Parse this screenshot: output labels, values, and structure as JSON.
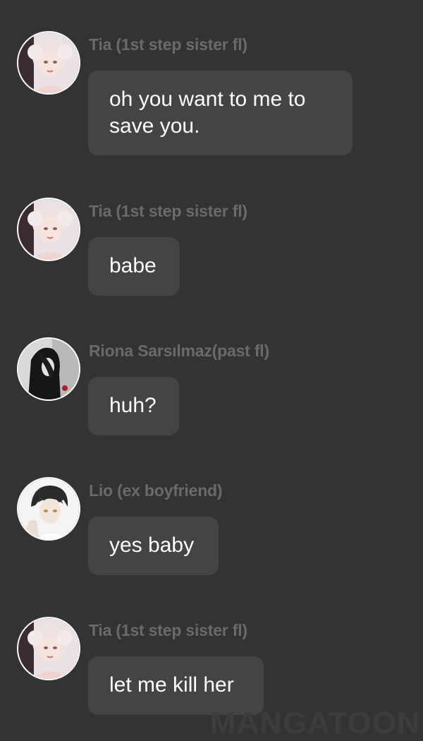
{
  "messages": [
    {
      "sender": "Tia (1st step sister fl)",
      "text": "oh you want to me to save you.",
      "avatar": "tia-avatar"
    },
    {
      "sender": "Tia (1st step sister fl)",
      "text": "babe",
      "avatar": "tia-avatar"
    },
    {
      "sender": "Riona Sarsılmaz(past fl)",
      "text": "huh?",
      "avatar": "riona-avatar"
    },
    {
      "sender": "Lio (ex boyfriend)",
      "text": "yes baby",
      "avatar": "lio-avatar"
    },
    {
      "sender": "Tia (1st step sister fl)",
      "text": "let me kill her",
      "avatar": "tia-avatar"
    }
  ],
  "watermark": "MANGATOON",
  "colors": {
    "background": "#333333",
    "bubble": "#444444",
    "sender_name": "#6a6a6a",
    "message_text": "#ffffff"
  }
}
